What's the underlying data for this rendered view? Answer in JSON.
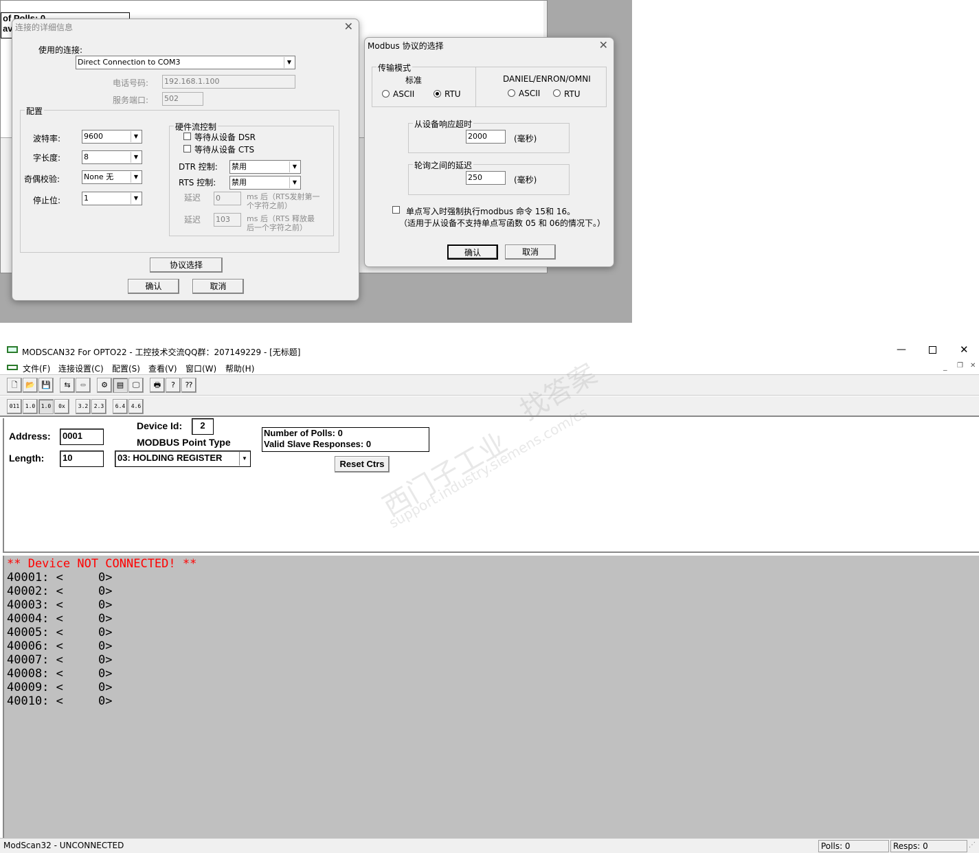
{
  "bg_window": {
    "polls_line1": "of Polls: 0",
    "polls_line2": "ave"
  },
  "connection_dialog": {
    "title": "连接的详细信息",
    "use_connection_label": "使用的连接:",
    "connection_value": "Direct Connection to COM3",
    "phone_label": "电话号码:",
    "phone_value": "192.168.1.100",
    "port_label": "服务端口:",
    "port_value": "502",
    "config_group": "配置",
    "baud_label": "波特率:",
    "baud_value": "9600",
    "word_label": "字长度:",
    "word_value": "8",
    "parity_label": "奇偶校验:",
    "parity_value": "None 无",
    "stop_label": "停止位:",
    "stop_value": "1",
    "hw_group": "硬件流控制",
    "wait_dsr": "等待从设备 DSR",
    "wait_cts": "等待从设备 CTS",
    "dtr_label": "DTR 控制:",
    "dtr_value": "禁用",
    "rts_label": "RTS 控制:",
    "rts_value": "禁用",
    "delay_label": "延迟",
    "delay1_value": "0",
    "delay1_note_a": "ms 后（RTS发射第一",
    "delay1_note_b": "个字符之前）",
    "delay2_value": "103",
    "delay2_note_a": "ms 后（RTS 释放最",
    "delay2_note_b": "后一个字符之前）",
    "protocol_button": "协议选择",
    "ok_button": "确认",
    "cancel_button": "取消"
  },
  "modbus_dialog": {
    "title": "Modbus 协议的选择",
    "transmit_group": "传输模式",
    "standard_label": "标准",
    "ascii": "ASCII",
    "rtu": "RTU",
    "daniel_label": "DANIEL/ENRON/OMNI",
    "timeout_group": "从设备响应超时",
    "timeout_value": "2000",
    "ms_unit": "(毫秒)",
    "delay_group": "轮询之间的延迟",
    "delay_value": "250",
    "force_line1": "单点写入时强制执行modbus 命令 15和 16。",
    "force_line2": "（适用于从设备不支持单点写函数 05 和 06的情况下。）",
    "ok_button": "确认",
    "cancel_button": "取消"
  },
  "app": {
    "title": "MODSCAN32 For OPTO22 - 工控技术交流QQ群：207149229 - [无标题]",
    "menu": [
      "文件(F)",
      "连接设置(C)",
      "配置(S)",
      "查看(V)",
      "窗口(W)",
      "帮助(H)"
    ],
    "address_label": "Address:",
    "address_value": "0001",
    "length_label": "Length:",
    "length_value": "10",
    "device_id_label": "Device Id:",
    "device_id_value": "2",
    "point_type_label": "MODBUS Point Type",
    "point_type_value": "03: HOLDING REGISTER",
    "polls_line": "Number of Polls: 0",
    "responses_line": "Valid Slave Responses: 0",
    "reset_button": "Reset Ctrs",
    "not_connected": "** Device NOT CONNECTED! **",
    "registers": [
      "40001: <     0>",
      "40002: <     0>",
      "40003: <     0>",
      "40004: <     0>",
      "40005: <     0>",
      "40006: <     0>",
      "40007: <     0>",
      "40008: <     0>",
      "40009: <     0>",
      "40010: <     0>"
    ],
    "status_text": "ModScan32 - UNCONNECTED",
    "status_polls": "Polls: 0",
    "status_resps": "Resps: 0",
    "watermark1": "西门子工业",
    "watermark2": "support.industry.siemens.com/cs",
    "watermark3": "找答案",
    "colors": {
      "error_red": "#ff0000",
      "data_bg": "#c0c0c0"
    }
  }
}
